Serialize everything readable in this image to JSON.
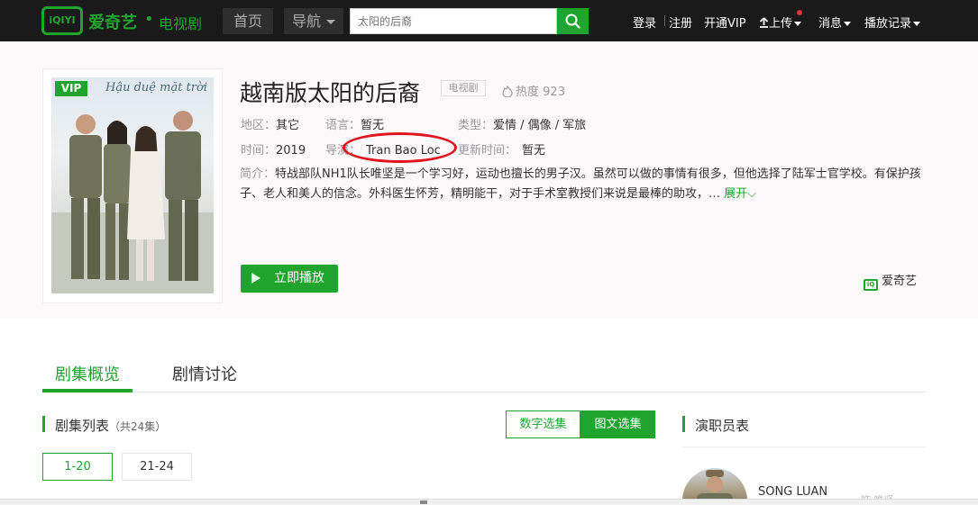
{
  "topbar": {
    "logo_mark": "iQIYI",
    "logo_text": "爱奇艺",
    "logo_dot": "•",
    "channel": "电视剧",
    "home": "首页",
    "nav": "导航",
    "search_placeholder": "太阳的后裔",
    "login": "登录",
    "register": "注册",
    "vip": "开通VIP",
    "upload": "上传",
    "messages": "消息",
    "history": "播放记录"
  },
  "show": {
    "vip_badge": "VIP",
    "poster_script": "Hậu duệ mặt trời",
    "title": "越南版太阳的后裔",
    "type_tag": "电视剧",
    "heat_label": "热度",
    "heat_value": "923",
    "region_label": "地区：",
    "region_value": "其它",
    "language_label": "语言：",
    "language_value": "暂无",
    "genre_label": "类型：",
    "genre_value": "爱情 / 偶像 / 军旅",
    "year_label": "时间：",
    "year_value": "2019",
    "director_label": "导演：",
    "director_value": "Tran Bao Loc",
    "update_label": "更新时间：",
    "update_value": "暂无",
    "synopsis_label": "简介：",
    "synopsis": "特战部队NH1队长唯坚是一个学习好，运动也擅长的男子汉。虽然可以做的事情有很多，但他选择了陆军士官学校。有保护孩子、老人和美人的信念。外科医生怀芳，精明能干，对于手术室教授们来说是最棒的助攻，…",
    "expand": "展开",
    "play_button": "立即播放",
    "source": "爱奇艺"
  },
  "tabs": [
    {
      "label": "剧集概览"
    },
    {
      "label": "剧情讨论"
    }
  ],
  "episodes": {
    "title": "剧集列表",
    "count": "（共24集）",
    "view_numbers": "数字选集",
    "view_images": "图文选集",
    "ranges": [
      "1-20",
      "21-24"
    ]
  },
  "cast": {
    "title": "演职员表",
    "members": [
      {
        "name": "SONG LUAN",
        "role": "饰 唯坚"
      }
    ]
  },
  "colors": {
    "brand_green": "#1fa42d",
    "topbar_bg": "#1a1a1a",
    "highlight_red": "#e0141e"
  },
  "icons": [
    "search-icon",
    "upload-icon",
    "heat-icon",
    "play-icon",
    "chevron-down-icon"
  ]
}
